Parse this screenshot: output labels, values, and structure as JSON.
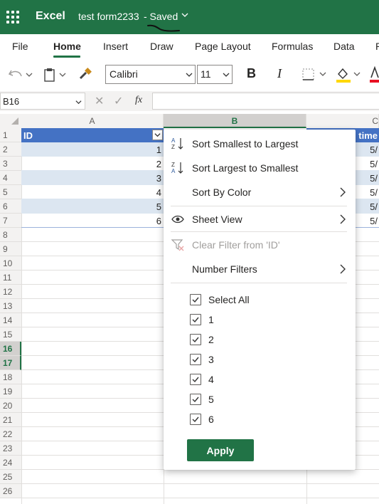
{
  "app": {
    "name": "Excel",
    "doc_title": "test form2233",
    "doc_status": "- Saved"
  },
  "tabs": [
    "File",
    "Home",
    "Insert",
    "Draw",
    "Page Layout",
    "Formulas",
    "Data",
    "R"
  ],
  "toolbar": {
    "font": "Calibri",
    "font_size": "11",
    "bold": "B",
    "italic": "I"
  },
  "formula_bar": {
    "name_box": "B16",
    "fx": "fx",
    "cancel": "✕",
    "enter": "✓"
  },
  "columns": [
    "A",
    "B",
    "C"
  ],
  "rows": [
    "1",
    "2",
    "3",
    "4",
    "5",
    "6",
    "7",
    "8",
    "9",
    "10",
    "11",
    "12",
    "13",
    "14",
    "15",
    "16",
    "17",
    "18",
    "19",
    "20",
    "21",
    "22",
    "23",
    "24",
    "25",
    "26"
  ],
  "table": {
    "header_a": "ID",
    "header_c": "n time",
    "ids": [
      "1",
      "2",
      "3",
      "4",
      "5",
      "6"
    ],
    "col_c_values": [
      "5/",
      "5/",
      "5/",
      "5/",
      "5/",
      "5/"
    ]
  },
  "filter_menu": {
    "sort_asc": "Sort Smallest to Largest",
    "sort_desc": "Sort Largest to Smallest",
    "sort_by_color": "Sort By Color",
    "sheet_view": "Sheet View",
    "clear_filter": "Clear Filter from 'ID'",
    "number_filters": "Number Filters",
    "select_all": "Select All",
    "values": [
      "1",
      "2",
      "3",
      "4",
      "5",
      "6"
    ],
    "apply": "Apply"
  },
  "colors": {
    "brand": "#217346",
    "table_header": "#4472c4",
    "band": "#dce6f1",
    "highlight_yellow": "#ffd800",
    "font_red": "#e81123"
  }
}
